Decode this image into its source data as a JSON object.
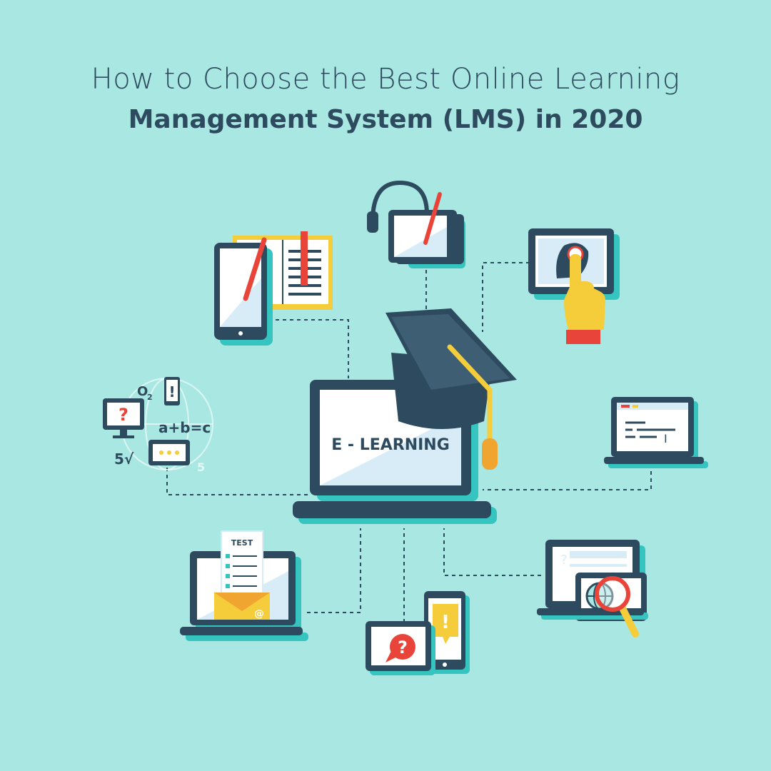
{
  "title": {
    "line1": "How to Choose the Best Online Learning",
    "line2": "Management System (LMS) in 2020"
  },
  "illustration": {
    "center_screen_text": "E - LEARNING",
    "test_sheet_label": "TEST",
    "formula_o2": "O",
    "formula_o2_sub": "2",
    "formula_abc": "a+b=c",
    "formula_root": "5√",
    "formula_five": "5",
    "question_mark": "?",
    "exclamation_mark": "!",
    "at_sign": "@",
    "cursor_glyph": "I"
  },
  "colors": {
    "background": "#a9e8e2",
    "dark": "#2d4a5e",
    "shadow": "#35c4c0",
    "screen": "#ffffff",
    "screen_tint": "#d8ecf8",
    "yellow": "#f5cc3a",
    "red": "#e8443a",
    "orange": "#f0a531"
  }
}
